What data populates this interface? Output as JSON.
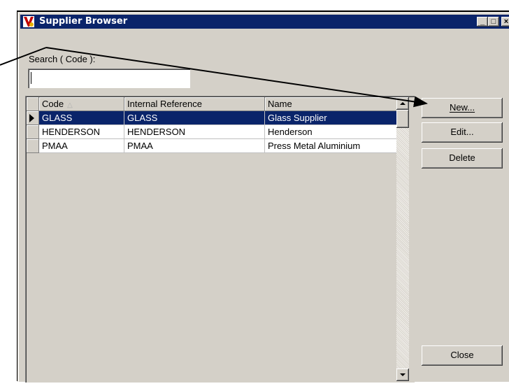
{
  "window": {
    "title": "Supplier Browser",
    "icon": "app-v-icon",
    "controls": {
      "minimize": "_",
      "maximize": "□",
      "close": "×"
    }
  },
  "search": {
    "label": "Search ( Code ):",
    "value": "",
    "placeholder": ""
  },
  "table": {
    "columns": [
      "Code",
      "Internal Reference",
      "Name"
    ],
    "sort": {
      "column": "Code",
      "direction": "ascending",
      "indicator": "△"
    },
    "rows": [
      {
        "code": "GLASS",
        "internal_reference": "GLASS",
        "name": "Glass Supplier",
        "selected": true
      },
      {
        "code": "HENDERSON",
        "internal_reference": "HENDERSON",
        "name": "Henderson",
        "selected": false
      },
      {
        "code": "PMAA",
        "internal_reference": "PMAA",
        "name": "Press Metal Aluminium",
        "selected": false
      }
    ]
  },
  "buttons": {
    "new": "New...",
    "edit": "Edit...",
    "delete": "Delete",
    "close": "Close"
  },
  "colors": {
    "titlebar": "#0a246a",
    "selection": "#0a246a",
    "face": "#d4d0c8"
  }
}
